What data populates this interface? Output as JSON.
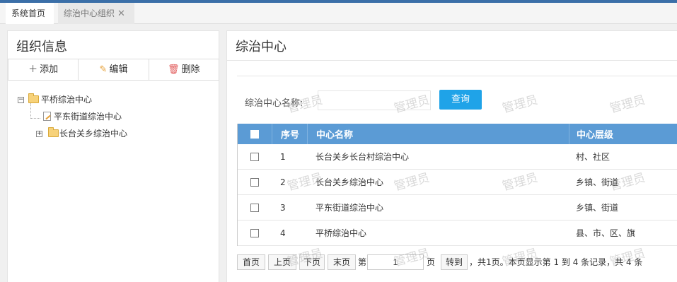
{
  "tabs": [
    {
      "label": "系统首页"
    },
    {
      "label": "综治中心组织"
    }
  ],
  "left_panel": {
    "title": "组织信息",
    "toolbar": {
      "add": "添加",
      "edit": "编辑",
      "delete": "删除"
    },
    "tree": [
      {
        "label": "平桥综治中心",
        "expanded": true,
        "toggle": "−"
      },
      {
        "label": "平东街道综治中心"
      },
      {
        "label": "长台关乡综治中心",
        "expanded": false,
        "toggle": "+"
      }
    ]
  },
  "right_panel": {
    "title": "综治中心",
    "search": {
      "label": "综治中心名称:",
      "value": "",
      "button": "查询"
    },
    "columns": {
      "index": "序号",
      "name": "中心名称",
      "level": "中心层级"
    },
    "rows": [
      {
        "index": "1",
        "name": "长台关乡长台村综治中心",
        "level": "村、社区"
      },
      {
        "index": "2",
        "name": "长台关乡综治中心",
        "level": "乡镇、街道"
      },
      {
        "index": "3",
        "name": "平东街道综治中心",
        "level": "乡镇、街道"
      },
      {
        "index": "4",
        "name": "平桥综治中心",
        "level": "县、市、区、旗"
      }
    ],
    "pager": {
      "first": "首页",
      "prev": "上页",
      "next": "下页",
      "last": "末页",
      "page_prefix": "第",
      "page_value": "1",
      "page_suffix": "页",
      "goto": "转到",
      "summary": "，共1页。本页显示第 1 到 4 条记录，共 4 条"
    }
  },
  "watermark": "管理员",
  "colors": {
    "accent": "#1fa3e8",
    "grid_header": "#5b9bd5",
    "topbar": "#3b6fa8"
  }
}
